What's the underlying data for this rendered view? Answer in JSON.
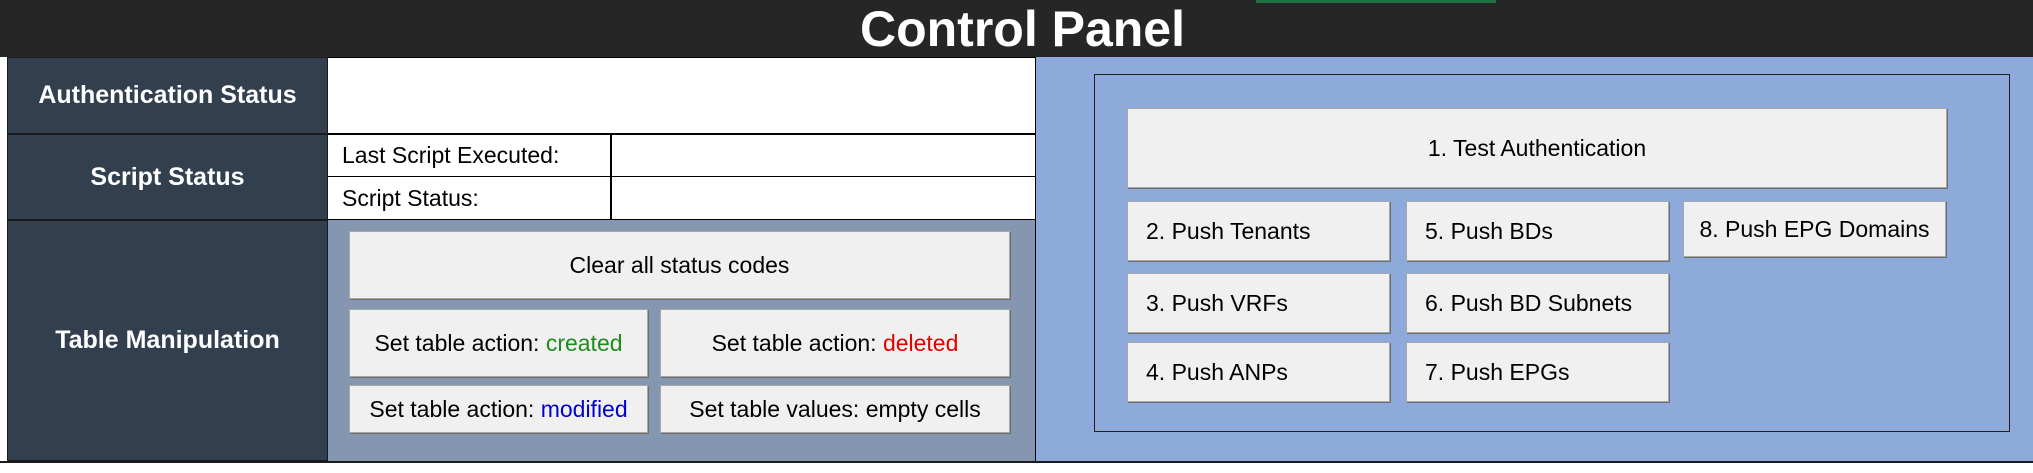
{
  "header": {
    "title": "Control Panel",
    "colors": {
      "background": "#262626",
      "text": "#ffffff"
    }
  },
  "sections": {
    "auth": {
      "label": "Authentication Status",
      "value": ""
    },
    "script": {
      "label": "Script Status",
      "last_script_label": "Last Script Executed:",
      "last_script_value": "",
      "status_label": "Script Status:",
      "status_value": ""
    },
    "table": {
      "label": "Table Manipulation",
      "buttons": {
        "clear": "Clear all status codes",
        "created_prefix": "Set table action: ",
        "created_value": "created",
        "deleted_prefix": "Set table action: ",
        "deleted_value": "deleted",
        "modified_prefix": "Set table action: ",
        "modified_value": "modified",
        "empty_cells": "Set table values: empty cells"
      }
    }
  },
  "actions": {
    "test_auth": "1. Test Authentication",
    "push_tenants": "2. Push Tenants",
    "push_vrfs": "3. Push VRFs",
    "push_anps": "4. Push ANPs",
    "push_bds": "5. Push BDs",
    "push_bd_subnets": "6. Push BD Subnets",
    "push_epgs": "7. Push EPGs",
    "push_epg_domains": "8. Push EPG Domains"
  },
  "colors": {
    "label_navy": "#323f4f",
    "panel_grey": "#8496b0",
    "panel_blue": "#8eaadb",
    "button": "#f0f0f0",
    "created": "#1e8b1e",
    "deleted": "#e00000",
    "modified": "#0000d0"
  }
}
